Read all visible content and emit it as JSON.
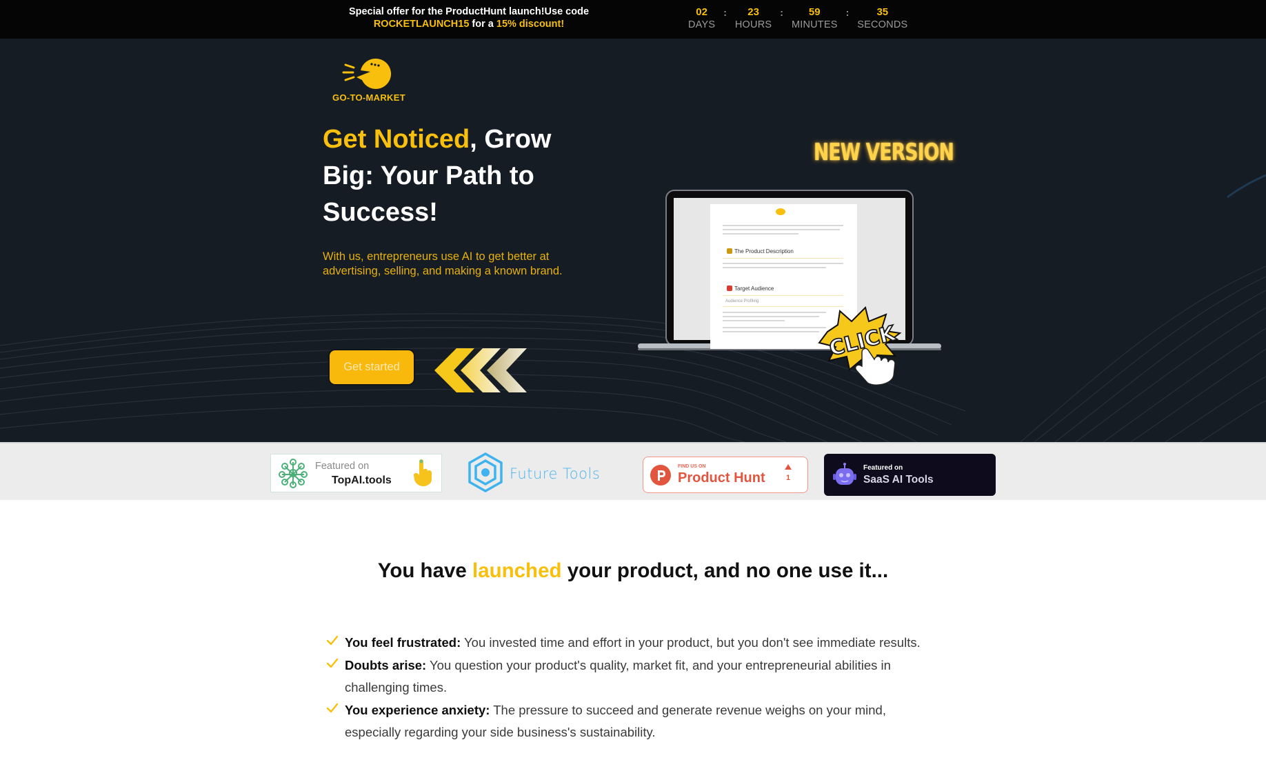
{
  "banner": {
    "text_before": "Special offer for the ProductHunt launch!Use code",
    "code": "ROCKETLAUNCH15",
    "text_middle": " for a ",
    "discount": "15% discount!",
    "countdown": [
      {
        "value": "02",
        "label": "DAYS"
      },
      {
        "value": "23",
        "label": "HOURS"
      },
      {
        "value": "59",
        "label": "MINUTES"
      },
      {
        "value": "35",
        "label": "SECONDS"
      }
    ],
    "separator": ":"
  },
  "colors": {
    "accent": "#f8bf0c",
    "hero_bg": "#161c24",
    "banner_bg": "#050505",
    "logos_bar_bg": "#ececec"
  },
  "hero": {
    "logo_text": "GO-TO-MARKET",
    "logo_icon": "pacman-megaphone-icon",
    "headline_highlight": "Get Noticed",
    "headline_rest": ", Grow Big: Your Path to Success!",
    "subtext": "With us, entrepreneurs use AI to get better at advertising, selling, and making a known brand.",
    "cta_label": "Get started",
    "cta_decoration": "chevrons-left-icon",
    "badge_new_version": "NEW VERSION",
    "click_badge": "CLICK",
    "screen": {
      "section1": "The Product Description",
      "section2": "Target Audience",
      "subsection": "Audience Profiling"
    }
  },
  "featured": [
    {
      "id": "topai",
      "line1": "Featured on",
      "line2": "TopAI.tools"
    },
    {
      "id": "futuretools",
      "line1": "Future Tools"
    },
    {
      "id": "producthunt",
      "line1": "FIND US ON",
      "line2": "Product Hunt",
      "upvotes": "1"
    },
    {
      "id": "saas",
      "line1": "Featured on",
      "line2": "SaaS AI Tools"
    }
  ],
  "problem": {
    "title_before": "You have ",
    "title_highlight": "launched",
    "title_after": " your product, and no one use it...",
    "items": [
      {
        "bold": "You feel frustrated:",
        "text": " You invested time and effort in your product, but you don't see immediate results."
      },
      {
        "bold": "Doubts arise:",
        "text": " You question your product's quality, market fit, and your entrepreneurial abilities in challenging times."
      },
      {
        "bold": "You experience anxiety:",
        "text": " The pressure to succeed and generate revenue weighs on your mind, especially regarding your side business's sustainability."
      }
    ]
  }
}
